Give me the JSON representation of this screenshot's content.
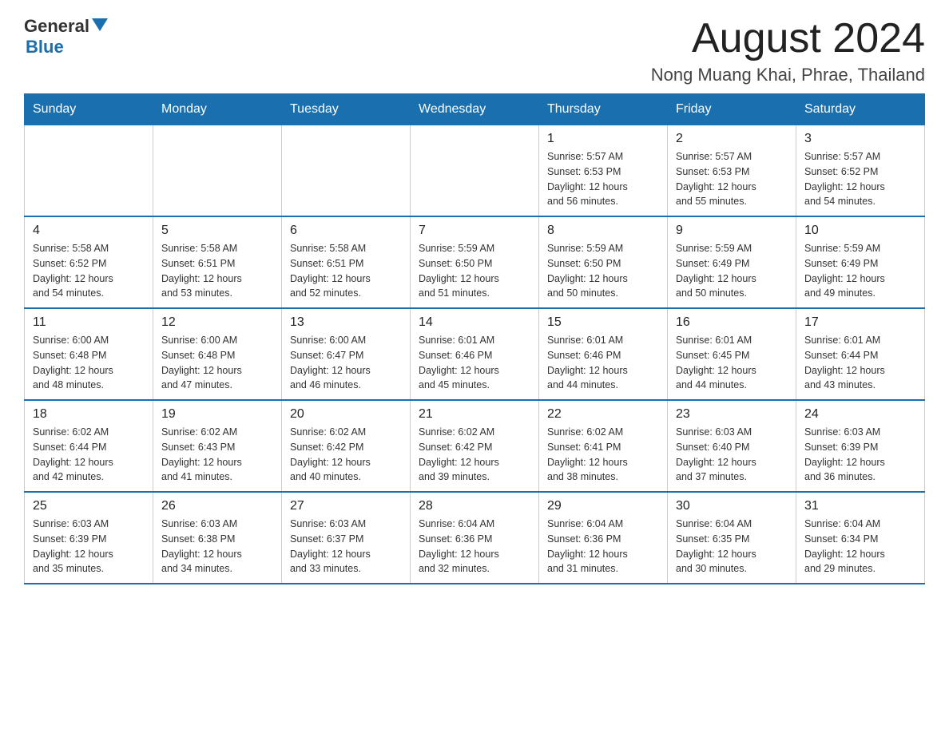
{
  "header": {
    "logo_general": "General",
    "logo_blue": "Blue",
    "month_title": "August 2024",
    "location": "Nong Muang Khai, Phrae, Thailand"
  },
  "days_of_week": [
    "Sunday",
    "Monday",
    "Tuesday",
    "Wednesday",
    "Thursday",
    "Friday",
    "Saturday"
  ],
  "weeks": [
    [
      {
        "day": "",
        "info": ""
      },
      {
        "day": "",
        "info": ""
      },
      {
        "day": "",
        "info": ""
      },
      {
        "day": "",
        "info": ""
      },
      {
        "day": "1",
        "info": "Sunrise: 5:57 AM\nSunset: 6:53 PM\nDaylight: 12 hours\nand 56 minutes."
      },
      {
        "day": "2",
        "info": "Sunrise: 5:57 AM\nSunset: 6:53 PM\nDaylight: 12 hours\nand 55 minutes."
      },
      {
        "day": "3",
        "info": "Sunrise: 5:57 AM\nSunset: 6:52 PM\nDaylight: 12 hours\nand 54 minutes."
      }
    ],
    [
      {
        "day": "4",
        "info": "Sunrise: 5:58 AM\nSunset: 6:52 PM\nDaylight: 12 hours\nand 54 minutes."
      },
      {
        "day": "5",
        "info": "Sunrise: 5:58 AM\nSunset: 6:51 PM\nDaylight: 12 hours\nand 53 minutes."
      },
      {
        "day": "6",
        "info": "Sunrise: 5:58 AM\nSunset: 6:51 PM\nDaylight: 12 hours\nand 52 minutes."
      },
      {
        "day": "7",
        "info": "Sunrise: 5:59 AM\nSunset: 6:50 PM\nDaylight: 12 hours\nand 51 minutes."
      },
      {
        "day": "8",
        "info": "Sunrise: 5:59 AM\nSunset: 6:50 PM\nDaylight: 12 hours\nand 50 minutes."
      },
      {
        "day": "9",
        "info": "Sunrise: 5:59 AM\nSunset: 6:49 PM\nDaylight: 12 hours\nand 50 minutes."
      },
      {
        "day": "10",
        "info": "Sunrise: 5:59 AM\nSunset: 6:49 PM\nDaylight: 12 hours\nand 49 minutes."
      }
    ],
    [
      {
        "day": "11",
        "info": "Sunrise: 6:00 AM\nSunset: 6:48 PM\nDaylight: 12 hours\nand 48 minutes."
      },
      {
        "day": "12",
        "info": "Sunrise: 6:00 AM\nSunset: 6:48 PM\nDaylight: 12 hours\nand 47 minutes."
      },
      {
        "day": "13",
        "info": "Sunrise: 6:00 AM\nSunset: 6:47 PM\nDaylight: 12 hours\nand 46 minutes."
      },
      {
        "day": "14",
        "info": "Sunrise: 6:01 AM\nSunset: 6:46 PM\nDaylight: 12 hours\nand 45 minutes."
      },
      {
        "day": "15",
        "info": "Sunrise: 6:01 AM\nSunset: 6:46 PM\nDaylight: 12 hours\nand 44 minutes."
      },
      {
        "day": "16",
        "info": "Sunrise: 6:01 AM\nSunset: 6:45 PM\nDaylight: 12 hours\nand 44 minutes."
      },
      {
        "day": "17",
        "info": "Sunrise: 6:01 AM\nSunset: 6:44 PM\nDaylight: 12 hours\nand 43 minutes."
      }
    ],
    [
      {
        "day": "18",
        "info": "Sunrise: 6:02 AM\nSunset: 6:44 PM\nDaylight: 12 hours\nand 42 minutes."
      },
      {
        "day": "19",
        "info": "Sunrise: 6:02 AM\nSunset: 6:43 PM\nDaylight: 12 hours\nand 41 minutes."
      },
      {
        "day": "20",
        "info": "Sunrise: 6:02 AM\nSunset: 6:42 PM\nDaylight: 12 hours\nand 40 minutes."
      },
      {
        "day": "21",
        "info": "Sunrise: 6:02 AM\nSunset: 6:42 PM\nDaylight: 12 hours\nand 39 minutes."
      },
      {
        "day": "22",
        "info": "Sunrise: 6:02 AM\nSunset: 6:41 PM\nDaylight: 12 hours\nand 38 minutes."
      },
      {
        "day": "23",
        "info": "Sunrise: 6:03 AM\nSunset: 6:40 PM\nDaylight: 12 hours\nand 37 minutes."
      },
      {
        "day": "24",
        "info": "Sunrise: 6:03 AM\nSunset: 6:39 PM\nDaylight: 12 hours\nand 36 minutes."
      }
    ],
    [
      {
        "day": "25",
        "info": "Sunrise: 6:03 AM\nSunset: 6:39 PM\nDaylight: 12 hours\nand 35 minutes."
      },
      {
        "day": "26",
        "info": "Sunrise: 6:03 AM\nSunset: 6:38 PM\nDaylight: 12 hours\nand 34 minutes."
      },
      {
        "day": "27",
        "info": "Sunrise: 6:03 AM\nSunset: 6:37 PM\nDaylight: 12 hours\nand 33 minutes."
      },
      {
        "day": "28",
        "info": "Sunrise: 6:04 AM\nSunset: 6:36 PM\nDaylight: 12 hours\nand 32 minutes."
      },
      {
        "day": "29",
        "info": "Sunrise: 6:04 AM\nSunset: 6:36 PM\nDaylight: 12 hours\nand 31 minutes."
      },
      {
        "day": "30",
        "info": "Sunrise: 6:04 AM\nSunset: 6:35 PM\nDaylight: 12 hours\nand 30 minutes."
      },
      {
        "day": "31",
        "info": "Sunrise: 6:04 AM\nSunset: 6:34 PM\nDaylight: 12 hours\nand 29 minutes."
      }
    ]
  ]
}
